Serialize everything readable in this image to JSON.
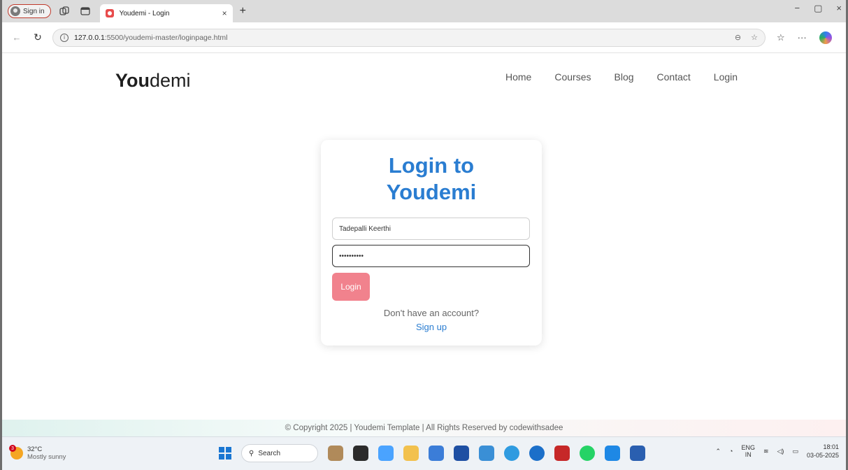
{
  "browser": {
    "signin_label": "Sign in",
    "tab_title": "Youdemi - Login",
    "tab_close": "×",
    "new_tab": "+",
    "url_host": "127.0.0.1",
    "url_path": ":5500/youdemi-master/loginpage.html",
    "window_minimize": "−",
    "window_restore": "▢",
    "window_close": "×"
  },
  "site": {
    "logo_bold": "You",
    "logo_light": "demi",
    "nav": [
      "Home",
      "Courses",
      "Blog",
      "Contact",
      "Login"
    ]
  },
  "login": {
    "heading_line1": "Login to",
    "heading_line2": "Youdemi",
    "username_value": "Tadepalli Keerthi",
    "password_value": "••••••••••",
    "login_button": "Login",
    "no_account_text": "Don't have an account?",
    "signup_link": "Sign up"
  },
  "footer": {
    "copyright": "© Copyright 2025 | Youdemi Template | All Rights Reserved by codewithsadee"
  },
  "taskbar": {
    "weather_temp": "32°C",
    "weather_desc": "Mostly sunny",
    "weather_badge": "3",
    "search_label": "Search",
    "lang_top": "ENG",
    "lang_bottom": "IN",
    "time": "18:01",
    "date": "03-05-2025"
  },
  "colors": {
    "accent_blue": "#2a7dd1",
    "login_button": "#f1828d",
    "signin_border": "#c0392b"
  }
}
